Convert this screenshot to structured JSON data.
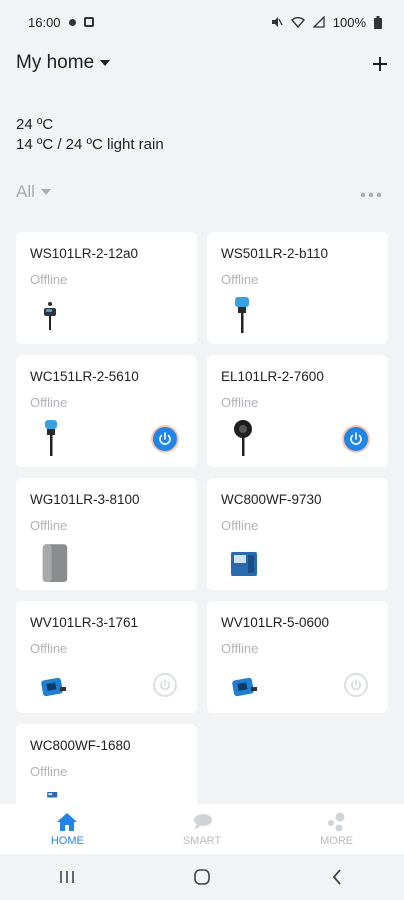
{
  "status_bar": {
    "time": "16:00",
    "battery": "100%"
  },
  "header": {
    "home_name": "My home",
    "add_icon": "plus-icon"
  },
  "weather": {
    "current": "24 ºC",
    "range_and_condition": "14 ºC / 24 ºC  light rain"
  },
  "filter": {
    "label": "All",
    "more": "more-horizontal-icon"
  },
  "devices": [
    {
      "name": "WS101LR-2-12a0",
      "status": "Offline",
      "icon": "soil-sensor-small",
      "power": null
    },
    {
      "name": "WS501LR-2-b110",
      "status": "Offline",
      "icon": "soil-sensor-tall",
      "power": null
    },
    {
      "name": "WC151LR-2-5610",
      "status": "Offline",
      "icon": "soil-sensor-tall",
      "power": "on"
    },
    {
      "name": "EL101LR-2-7600",
      "status": "Offline",
      "icon": "spot-light",
      "power": "on"
    },
    {
      "name": "WG101LR-3-8100",
      "status": "Offline",
      "icon": "gateway-cylinder",
      "power": null
    },
    {
      "name": "WC800WF-9730",
      "status": "Offline",
      "icon": "controller-box",
      "power": null
    },
    {
      "name": "WV101LR-3-1761",
      "status": "Offline",
      "icon": "valve-controller",
      "power": "off"
    },
    {
      "name": "WV101LR-5-0600",
      "status": "Offline",
      "icon": "valve-controller",
      "power": "off"
    },
    {
      "name": "WC800WF-1680",
      "status": "Offline",
      "icon": "controller-box",
      "power": null
    }
  ],
  "bottom_nav": [
    {
      "label": "HOME",
      "icon": "home-icon",
      "active": true
    },
    {
      "label": "SMART",
      "icon": "chat-bubble-icon",
      "active": false
    },
    {
      "label": "MORE",
      "icon": "dots-cluster-icon",
      "active": false
    }
  ],
  "colors": {
    "accent": "#2185e8",
    "offline_text": "#b0b3b8",
    "background": "#f2f3f5"
  }
}
